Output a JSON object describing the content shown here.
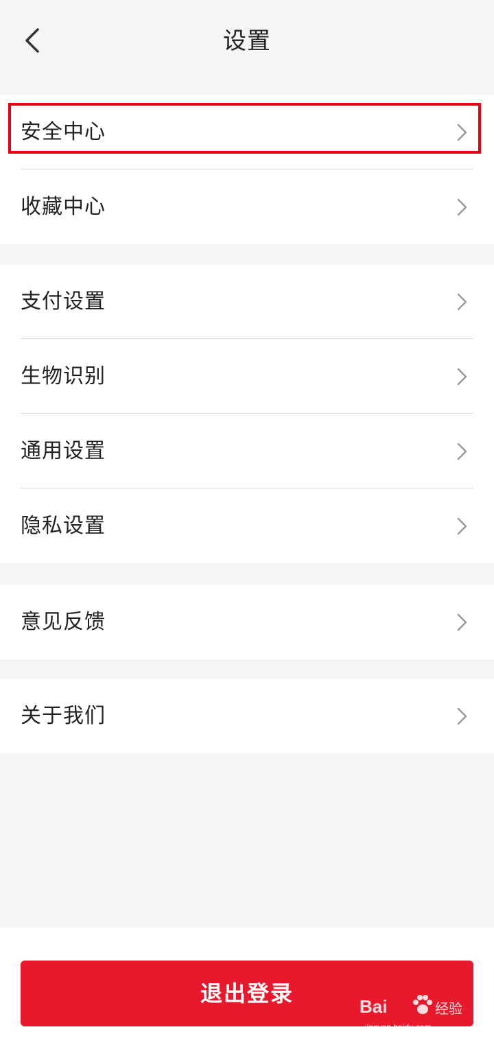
{
  "header": {
    "title": "设置",
    "back_icon": "chevron-left-icon"
  },
  "groups": [
    {
      "items": [
        {
          "label": "安全中心"
        },
        {
          "label": "收藏中心"
        }
      ]
    },
    {
      "items": [
        {
          "label": "支付设置"
        },
        {
          "label": "生物识别"
        },
        {
          "label": "通用设置"
        },
        {
          "label": "隐私设置"
        }
      ]
    },
    {
      "items": [
        {
          "label": "意见反馈"
        }
      ]
    },
    {
      "items": [
        {
          "label": "关于我们"
        }
      ]
    }
  ],
  "highlight": {
    "target": "安全中心",
    "color": "#e60012"
  },
  "logout": {
    "label": "退出登录",
    "color": "#e8192c"
  },
  "watermark": {
    "brand": "Bai",
    "brand_cn": "经验",
    "url": "jingyan.baidu.com"
  },
  "colors": {
    "background": "#f5f5f5",
    "card": "#ffffff",
    "divider": "#dcdcdc",
    "chevron": "#999999"
  }
}
